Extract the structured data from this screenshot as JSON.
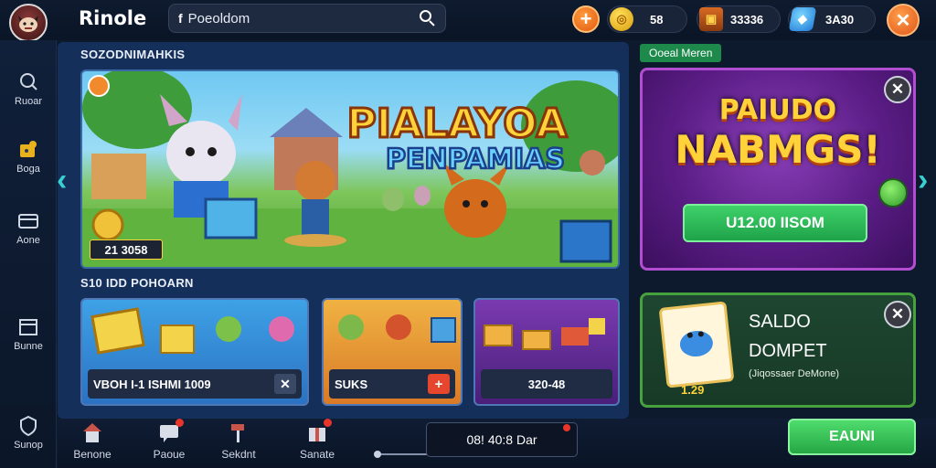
{
  "header": {
    "app_title": "Rinole",
    "search_prefix": "f",
    "search_value": "Poeoldom",
    "currencies": [
      {
        "icon": "gold-coin-icon",
        "value": "58"
      },
      {
        "icon": "treasure-chest-icon",
        "value": "33336"
      },
      {
        "icon": "blue-gem-icon",
        "value": "3A30"
      }
    ]
  },
  "sidebar": {
    "items": [
      {
        "label": "Ruoar",
        "icon": "search-icon"
      },
      {
        "label": "Boga",
        "icon": "gamepad-icon"
      },
      {
        "label": "Aone",
        "icon": "card-icon"
      },
      {
        "label": "Bunne",
        "icon": "window-icon"
      },
      {
        "label": "Sunop",
        "icon": "shield-icon"
      }
    ]
  },
  "main": {
    "featured_title": "SOZODNIMAHKIS",
    "banner": {
      "title_line1": "PIALAYOA",
      "title_line2": "PENPAMIAS",
      "counter_value": "21 3058"
    },
    "section2_title": "S10 IDD POHOARN",
    "cards": [
      {
        "label": "VBOH   I-1 ISHMI 1009",
        "action": "close"
      },
      {
        "label": "SUKS",
        "action": "add"
      },
      {
        "label": "320-48",
        "action": "none"
      }
    ]
  },
  "right_panel": {
    "tag": "Ooeal Meren",
    "promo": {
      "title_line1": "PAIUDO",
      "title_line2": "NABMGS!",
      "button_label": "U12.00 IISOM"
    },
    "wallet": {
      "title_line1": "SALDO",
      "title_line2": "DOMPET",
      "subtitle": "(Jiqossaer DeMone)",
      "card_value": "1.29"
    }
  },
  "bottom_bar": {
    "items": [
      {
        "label": "Benone",
        "icon": "house-icon",
        "badge": false
      },
      {
        "label": "Paoue",
        "icon": "chat-icon",
        "badge": true
      },
      {
        "label": "Sekdnt",
        "icon": "hammer-icon",
        "badge": false
      },
      {
        "label": "Sanate",
        "icon": "gift-icon",
        "badge": true
      }
    ],
    "timer": "08! 40:8 Dar",
    "play_label": "EAUNI"
  },
  "colors": {
    "accent_orange": "#e0551a",
    "accent_green": "#26a744",
    "accent_purple": "#b14dd0",
    "banner_title": "#ffd23a"
  }
}
